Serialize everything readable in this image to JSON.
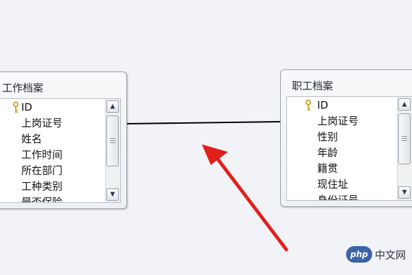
{
  "tables": {
    "left": {
      "title": "工作档案",
      "fields": [
        "ID",
        "上岗证号",
        "姓名",
        "工作时间",
        "所在部门",
        "工种类别",
        "是否保险"
      ]
    },
    "right": {
      "title": "职工档案",
      "fields": [
        "ID",
        "上岗证号",
        "性别",
        "年龄",
        "籍贯",
        "现住址",
        "身份证号"
      ]
    }
  },
  "watermark": {
    "logo": "php",
    "text": "中文网"
  },
  "colors": {
    "arrow": "#e0201c",
    "relationship_line": "#000000",
    "key_icon": "#c9a227"
  }
}
